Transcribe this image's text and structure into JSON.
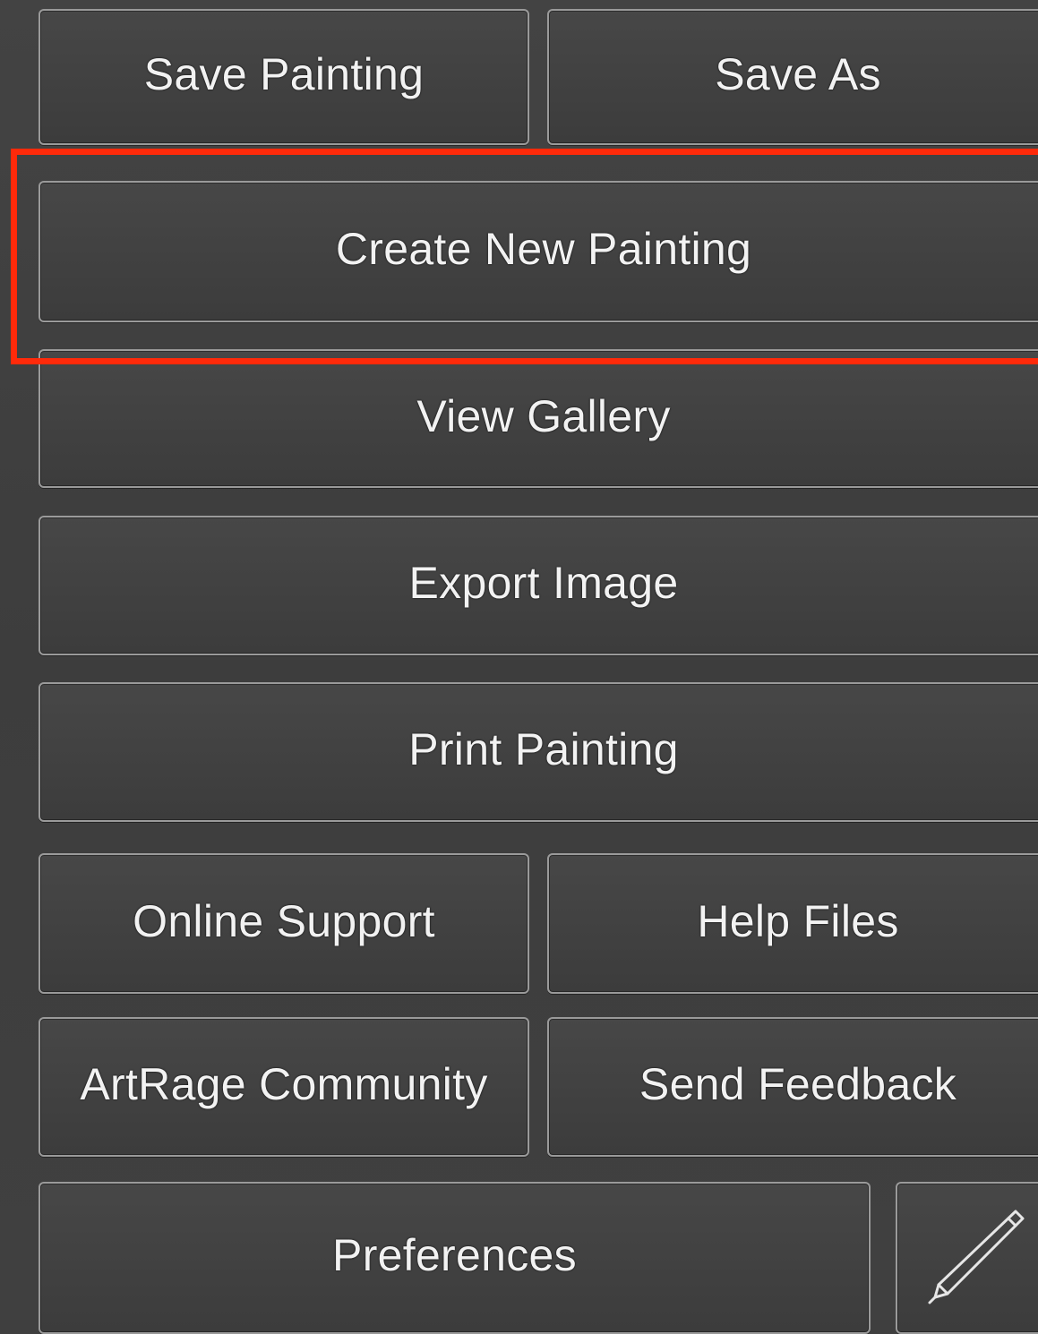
{
  "menu": {
    "save_painting": "Save Painting",
    "save_as": "Save As",
    "create_new_painting": "Create New Painting",
    "view_gallery": "View Gallery",
    "export_image": "Export Image",
    "print_painting": "Print Painting",
    "online_support": "Online Support",
    "help_files": "Help Files",
    "artrage_community": "ArtRage Community",
    "send_feedback": "Send Feedback",
    "preferences": "Preferences",
    "pencil_icon": "pencil-icon"
  },
  "colors": {
    "highlight": "#ff2a0a",
    "background": "#3f3f3f",
    "text": "#f2f2f2"
  }
}
